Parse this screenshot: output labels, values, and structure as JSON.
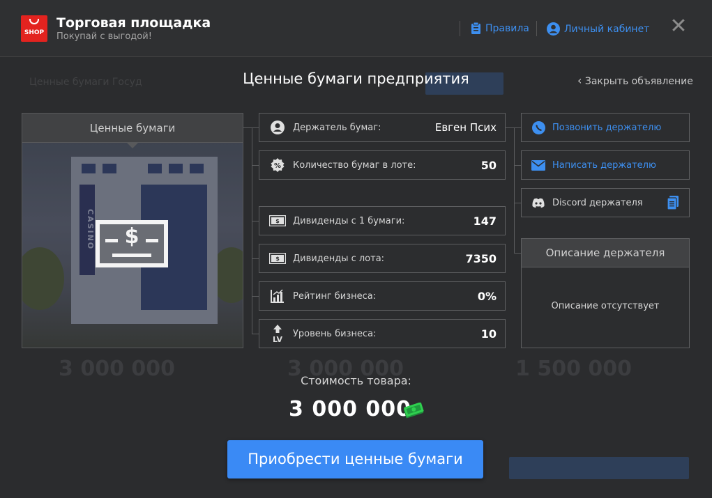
{
  "header": {
    "logo_text": "SHOP",
    "title": "Торговая площадка",
    "subtitle": "Покупай с выгодой!",
    "rules_label": "Правила",
    "account_label": "Личный кабинет",
    "close_glyph": "✕"
  },
  "background": {
    "tabs_text": "Ценные бумаги     Госуд",
    "prices": [
      "3 000 000",
      "3 000 000",
      "1 500 000"
    ]
  },
  "modal": {
    "title": "Ценные бумаги предприятия",
    "close_ad_label": "Закрыть объявление",
    "image_panel_title": "Ценные бумаги",
    "image_sign_text": "CASINO",
    "money_symbol": "$"
  },
  "info_rows": [
    {
      "label": "Держатель бумаг:",
      "value": "Евген Псих",
      "icon": "user-icon"
    },
    {
      "label": "Количество бумаг в лоте:",
      "value": "50",
      "icon": "percent-badge-icon"
    },
    {
      "label": "Дивиденды с 1 бумаги:",
      "value": "147",
      "icon": "banknote-icon"
    },
    {
      "label": "Дивиденды с лота:",
      "value": "7350",
      "icon": "banknote-icon"
    },
    {
      "label": "Рейтинг бизнеса:",
      "value": "0%",
      "icon": "rating-chart-icon"
    },
    {
      "label": "Уровень бизнеса:",
      "value": "10",
      "icon": "level-up-icon",
      "icon_text": "LV"
    }
  ],
  "contact": {
    "call_label": "Позвонить держателю",
    "message_label": "Написать держателю",
    "discord_label": "Discord держателя"
  },
  "description": {
    "title": "Описание держателя",
    "text": "Описание отсутствует"
  },
  "price": {
    "label": "Стоимость товара:",
    "value": "3 000 000"
  },
  "buy_button_label": "Приобрести ценные бумаги",
  "colors": {
    "accent": "#3a8af5",
    "link": "#3d8ff0",
    "background": "#2b2c2e",
    "logo_red": "#e3231f"
  }
}
